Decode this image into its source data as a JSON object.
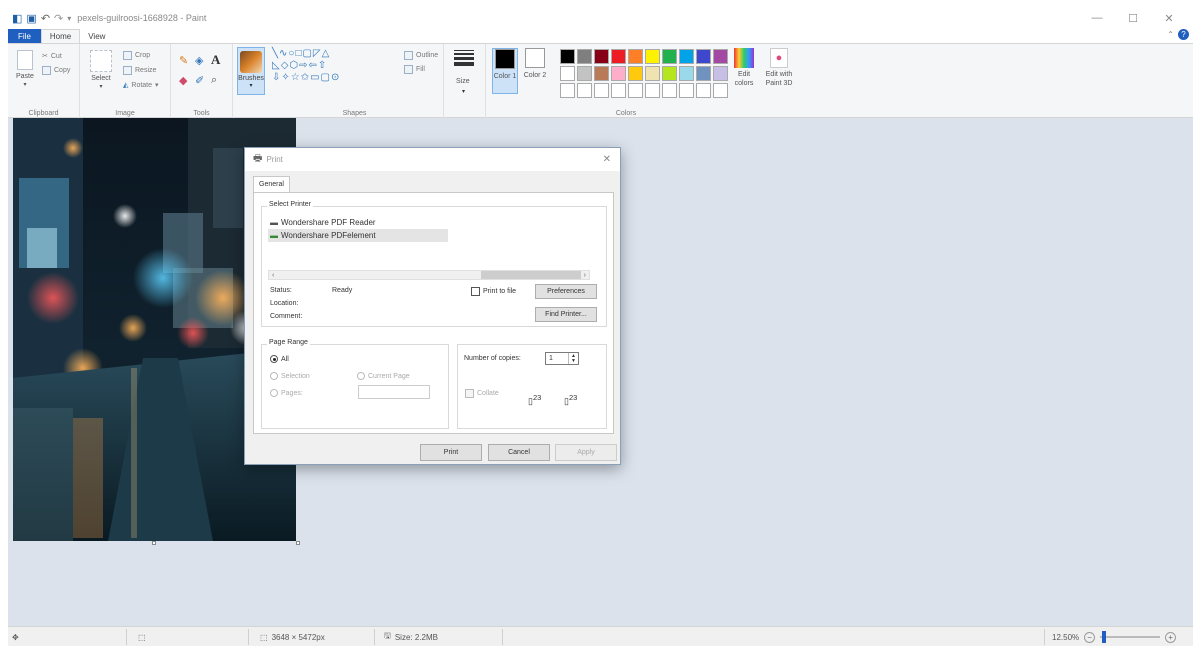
{
  "window": {
    "title": "pexels-guilroosi-1668928 - Paint",
    "controls": [
      "—",
      "☐",
      "✕"
    ]
  },
  "ribbon_tabs": {
    "file": "File",
    "home": "Home",
    "view": "View"
  },
  "clipboard": {
    "paste": "Paste",
    "cut": "Cut",
    "copy": "Copy",
    "label": "Clipboard"
  },
  "image": {
    "select": "Select",
    "crop": "Crop",
    "resize": "Resize",
    "rotate": "Rotate",
    "label": "Image"
  },
  "tools": {
    "label": "Tools",
    "brushes": "Brushes"
  },
  "shapes": {
    "outline": "Outline",
    "fill": "Fill",
    "label": "Shapes"
  },
  "size": {
    "label": "Size"
  },
  "colors": {
    "color1": "Color 1",
    "color2": "Color 2",
    "edit_colors": "Edit colors",
    "edit_paint3d": "Edit with Paint 3D",
    "label": "Colors",
    "color1_value": "#000000",
    "color2_value": "#ffffff",
    "palette": [
      "#000000",
      "#7f7f7f",
      "#880015",
      "#ed1c24",
      "#ff7f27",
      "#fff200",
      "#22b14c",
      "#00a2e8",
      "#3f48cc",
      "#a349a4",
      "#ffffff",
      "#c3c3c3",
      "#b97a57",
      "#ffaec9",
      "#ffc90e",
      "#efe4b0",
      "#b5e61d",
      "#99d9ea",
      "#7092be",
      "#c8bfe7",
      "#ffffff",
      "#ffffff",
      "#ffffff",
      "#ffffff",
      "#ffffff",
      "#ffffff",
      "#ffffff",
      "#ffffff",
      "#ffffff",
      "#ffffff"
    ]
  },
  "statusbar": {
    "dimensions": "3648 × 5472px",
    "size": "Size: 2.2MB",
    "zoom": "12.50%"
  },
  "print_dialog": {
    "title": "Print",
    "tab": "General",
    "select_printer_label": "Select Printer",
    "printers": [
      {
        "name": "Wondershare PDF Reader",
        "selected": false
      },
      {
        "name": "Wondershare PDFelement",
        "selected": true
      }
    ],
    "status_label": "Status:",
    "status_value": "Ready",
    "location_label": "Location:",
    "comment_label": "Comment:",
    "print_to_file": "Print to file",
    "preferences": "Preferences",
    "find_printer": "Find Printer...",
    "page_range_label": "Page Range",
    "all": "All",
    "selection": "Selection",
    "current_page": "Current Page",
    "pages": "Pages:",
    "copies_label": "Number of copies:",
    "copies_value": "1",
    "collate": "Collate",
    "print_btn": "Print",
    "cancel_btn": "Cancel",
    "apply_btn": "Apply"
  }
}
